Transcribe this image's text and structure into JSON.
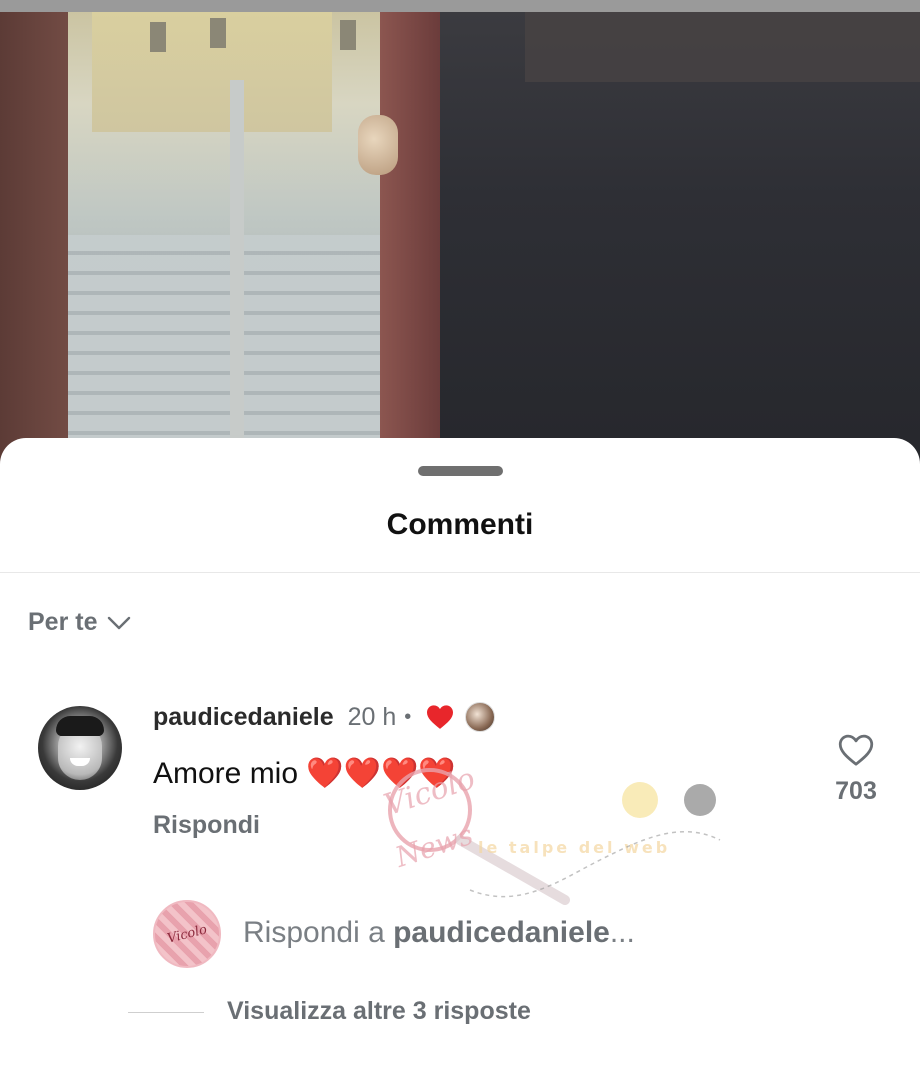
{
  "sheet": {
    "title": "Commenti"
  },
  "sort": {
    "label": "Per te",
    "icon": "chevron-down-icon"
  },
  "comment": {
    "username": "paudicedaniele",
    "time": "20 h",
    "separator": "•",
    "creator_liked_icon": "heart-filled-icon",
    "text": "Amore mio ❤️❤️❤️❤️",
    "reply_label": "Rispondi",
    "like_count": "703",
    "like_icon": "heart-outline-icon"
  },
  "reply_box": {
    "prefix": "Rispondi a ",
    "username": "paudicedaniele",
    "suffix": "..."
  },
  "more_replies": "Visualizza altre 3 risposte",
  "watermark": {
    "text1": "Vicolo delle News",
    "text2": "le talpe del web"
  },
  "colors": {
    "accent_red": "#e8262b",
    "muted_text": "#6a6f74"
  }
}
